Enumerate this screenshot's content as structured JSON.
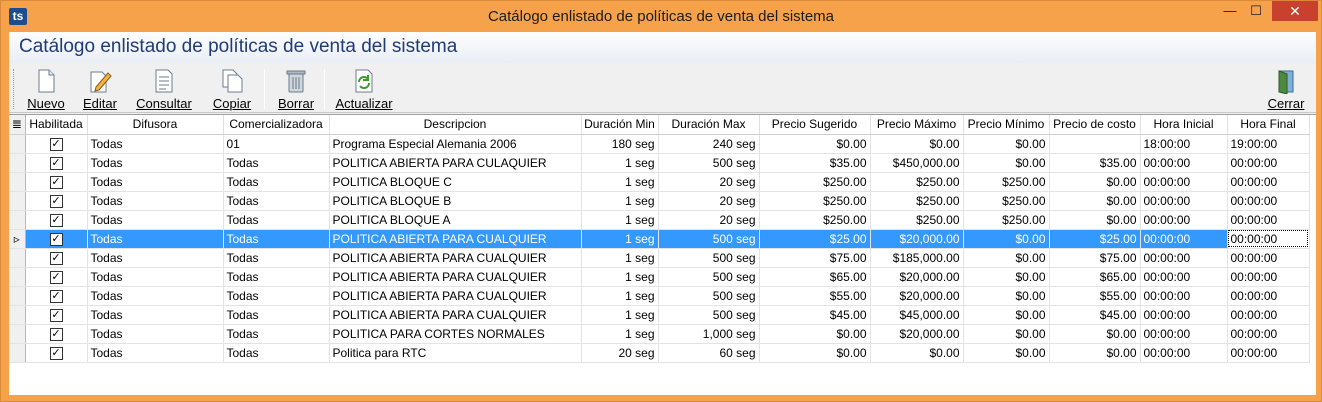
{
  "window": {
    "app_icon": "ts",
    "title": "Catálogo enlistado de políticas de venta del sistema",
    "min_glyph": "—",
    "max_glyph": "☐",
    "close_glyph": "✕"
  },
  "page_title": "Catálogo enlistado de políticas de venta del sistema",
  "toolbar": {
    "nuevo": "Nuevo",
    "editar": "Editar",
    "consultar": "Consultar",
    "copiar": "Copiar",
    "borrar": "Borrar",
    "actualizar": "Actualizar",
    "cerrar": "Cerrar"
  },
  "grid": {
    "row_header_icon": "≣",
    "columns": [
      "Habilitada",
      "Difusora",
      "Comercializadora",
      "Descripcion",
      "Duración Min",
      "Duración Max",
      "Precio Sugerido",
      "Precio Máximo",
      "Precio Mínimo",
      "Precio de costo",
      "Hora Inicial",
      "Hora Final"
    ],
    "selected_row": 5,
    "rows": [
      [
        "✓",
        "Todas",
        "01",
        "Programa Especial Alemania 2006",
        "180 seg",
        "240 seg",
        "$0.00",
        "$0.00",
        "$0.00",
        "",
        "18:00:00",
        "19:00:00"
      ],
      [
        "✓",
        "Todas",
        "Todas",
        "POLITICA  ABIERTA PARA CULAQUIER",
        "1 seg",
        "500 seg",
        "$35.00",
        "$450,000.00",
        "$0.00",
        "$35.00",
        "00:00:00",
        "00:00:00"
      ],
      [
        "✓",
        "Todas",
        "Todas",
        "POLITICA BLOQUE C",
        "1 seg",
        "20 seg",
        "$250.00",
        "$250.00",
        "$250.00",
        "$0.00",
        "00:00:00",
        "00:00:00"
      ],
      [
        "✓",
        "Todas",
        "Todas",
        "POLITICA BLOQUE B",
        "1 seg",
        "20 seg",
        "$250.00",
        "$250.00",
        "$250.00",
        "$0.00",
        "00:00:00",
        "00:00:00"
      ],
      [
        "✓",
        "Todas",
        "Todas",
        "POLITICA BLOQUE A",
        "1 seg",
        "20 seg",
        "$250.00",
        "$250.00",
        "$250.00",
        "$0.00",
        "00:00:00",
        "00:00:00"
      ],
      [
        "✓",
        "Todas",
        "Todas",
        "POLITICA ABIERTA PARA CUALQUIER",
        "1 seg",
        "500 seg",
        "$25.00",
        "$20,000.00",
        "$0.00",
        "$25.00",
        "00:00:00",
        "00:00:00"
      ],
      [
        "✓",
        "Todas",
        "Todas",
        "POLITICA ABIERTA PARA CUALQUIER",
        "1 seg",
        "500 seg",
        "$75.00",
        "$185,000.00",
        "$0.00",
        "$75.00",
        "00:00:00",
        "00:00:00"
      ],
      [
        "✓",
        "Todas",
        "Todas",
        "POLITICA ABIERTA PARA CUALQUIER",
        "1 seg",
        "500 seg",
        "$65.00",
        "$20,000.00",
        "$0.00",
        "$65.00",
        "00:00:00",
        "00:00:00"
      ],
      [
        "✓",
        "Todas",
        "Todas",
        "POLITICA ABIERTA PARA CUALQUIER",
        "1 seg",
        "500 seg",
        "$55.00",
        "$20,000.00",
        "$0.00",
        "$55.00",
        "00:00:00",
        "00:00:00"
      ],
      [
        "✓",
        "Todas",
        "Todas",
        "POLITICA ABIERTA PARA CUALQUIER",
        "1 seg",
        "500 seg",
        "$45.00",
        "$45,000.00",
        "$0.00",
        "$45.00",
        "00:00:00",
        "00:00:00"
      ],
      [
        "✓",
        "Todas",
        "Todas",
        "POLITICA PARA CORTES NORMALES",
        "1 seg",
        "1,000 seg",
        "$0.00",
        "$20,000.00",
        "$0.00",
        "$0.00",
        "00:00:00",
        "00:00:00"
      ],
      [
        "✓",
        "Todas",
        "Todas",
        "Politica para RTC",
        "20 seg",
        "60 seg",
        "$0.00",
        "$0.00",
        "$0.00",
        "$0.00",
        "00:00:00",
        "00:00:00"
      ]
    ],
    "current_row_marker": "▹"
  },
  "colors": {
    "window_frame": "#f6a24b",
    "close_button": "#c7412c",
    "title_text": "#1e3c78",
    "selection": "#3399ff"
  }
}
